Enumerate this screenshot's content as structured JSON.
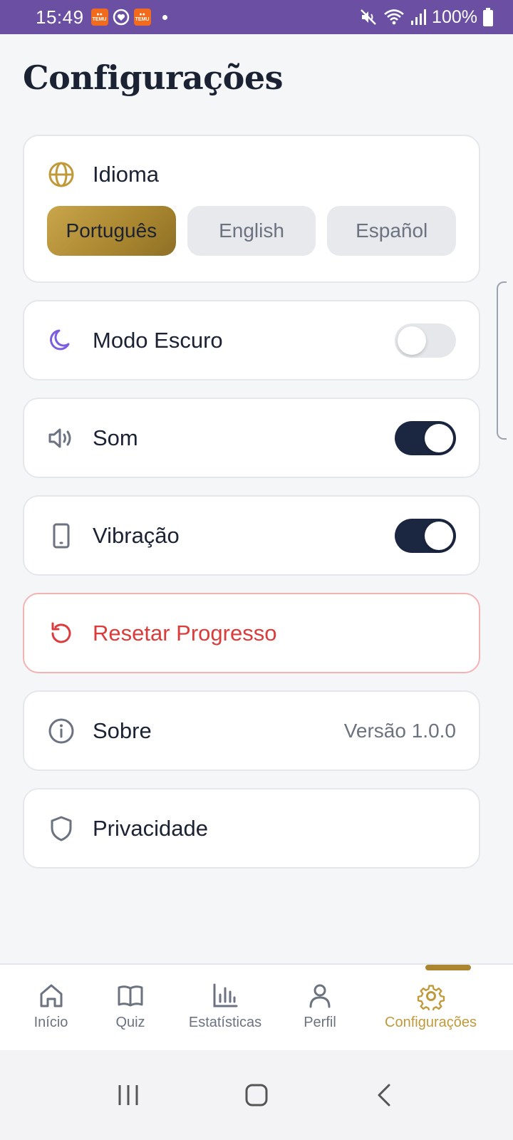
{
  "status_bar": {
    "time": "15:49",
    "app_badge_label": "TEMU",
    "battery": "100%"
  },
  "page": {
    "title": "Configurações"
  },
  "language": {
    "label": "Idioma",
    "options": [
      "Português",
      "English",
      "Español"
    ],
    "selected": "Português"
  },
  "dark_mode": {
    "label": "Modo Escuro",
    "enabled": false
  },
  "sound": {
    "label": "Som",
    "enabled": true
  },
  "vibration": {
    "label": "Vibração",
    "enabled": true
  },
  "reset": {
    "label": "Resetar Progresso"
  },
  "about": {
    "label": "Sobre",
    "version": "Versão 1.0.0"
  },
  "privacy": {
    "label": "Privacidade"
  },
  "bottom_nav": {
    "items": [
      {
        "label": "Início",
        "icon": "home-icon"
      },
      {
        "label": "Quiz",
        "icon": "book-icon"
      },
      {
        "label": "Estatísticas",
        "icon": "bar-chart-icon"
      },
      {
        "label": "Perfil",
        "icon": "user-icon"
      },
      {
        "label": "Configurações",
        "icon": "gear-icon"
      }
    ],
    "active": "Configurações"
  },
  "colors": {
    "accent_gold": "#c09a3a",
    "status_bar": "#6a4fa3",
    "toggle_on": "#1b2640",
    "danger": "#dc3b3b",
    "moon": "#7c5ce0"
  }
}
